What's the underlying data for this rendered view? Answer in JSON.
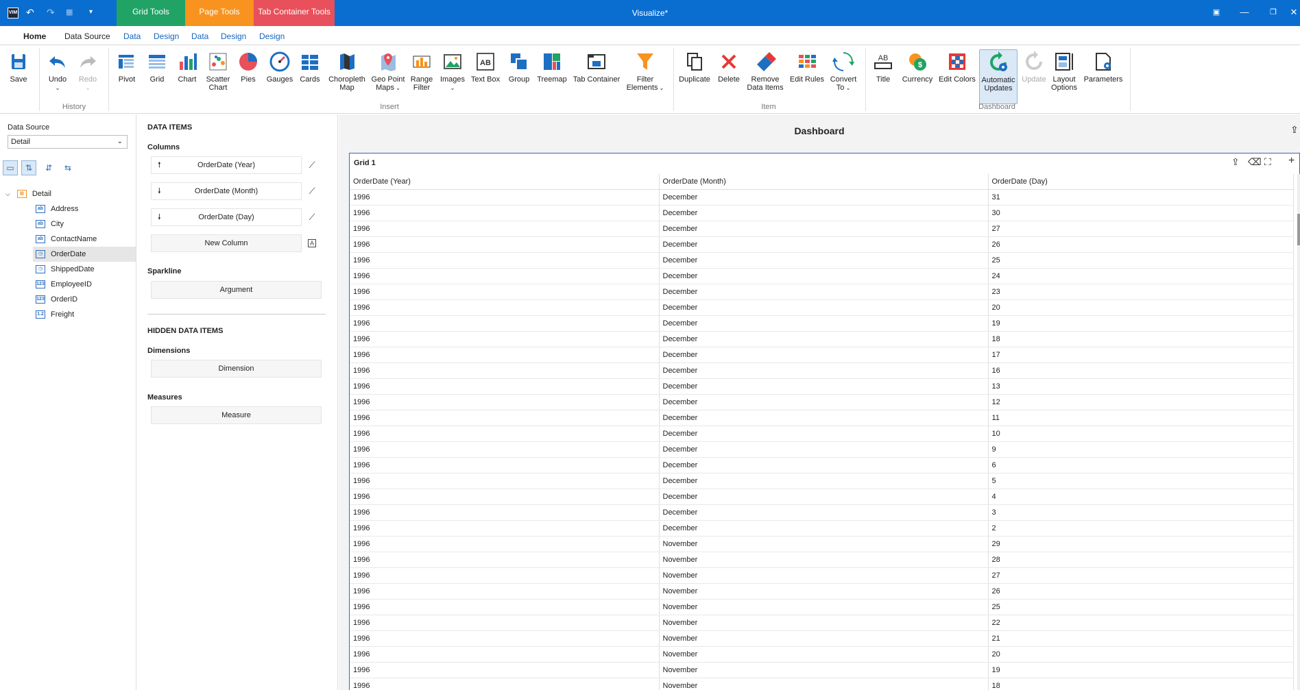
{
  "titlebar": {
    "app_title": "Visualize*",
    "logo": "VIM",
    "context_tabs": [
      {
        "label": "Grid Tools",
        "color": "#21a366"
      },
      {
        "label": "Page Tools",
        "color": "#f7931e"
      },
      {
        "label": "Tab Container Tools",
        "color": "#e8505b"
      }
    ]
  },
  "tabs": [
    "Home",
    "Data Source",
    "Data",
    "Design",
    "Data",
    "Design",
    "Design"
  ],
  "ribbon": {
    "save": "Save",
    "undo": "Undo",
    "redo": "Redo",
    "history": "History",
    "insert": {
      "label": "Insert",
      "items": [
        "Pivot",
        "Grid",
        "Chart",
        "Scatter Chart",
        "Pies",
        "Gauges",
        "Cards",
        "Choropleth Map",
        "Geo Point Maps",
        "Range Filter",
        "Images",
        "Text Box",
        "Group",
        "Treemap",
        "Tab Container",
        "Filter Elements"
      ]
    },
    "item": {
      "label": "Item",
      "items": [
        "Duplicate",
        "Delete",
        "Remove Data Items",
        "Edit Rules",
        "Convert To"
      ]
    },
    "dashboard": {
      "label": "Dashboard",
      "items": [
        "Title",
        "Currency",
        "Edit Colors",
        "Automatic Updates",
        "Update",
        "Layout Options",
        "Parameters"
      ]
    }
  },
  "left": {
    "data_source_label": "Data Source",
    "data_source_value": "Detail",
    "tree_root": "Detail",
    "fields": [
      {
        "name": "Address",
        "type": "ab"
      },
      {
        "name": "City",
        "type": "ab"
      },
      {
        "name": "ContactName",
        "type": "ab"
      },
      {
        "name": "OrderDate",
        "type": "date"
      },
      {
        "name": "ShippedDate",
        "type": "date"
      },
      {
        "name": "EmployeeID",
        "type": "123"
      },
      {
        "name": "OrderID",
        "type": "123"
      },
      {
        "name": "Freight",
        "type": "1.2"
      }
    ],
    "selected_field": "OrderDate"
  },
  "mid": {
    "data_items": "DATA ITEMS",
    "columns": "Columns",
    "column_items": [
      "OrderDate (Year)",
      "OrderDate (Month)",
      "OrderDate (Day)"
    ],
    "new_column": "New Column",
    "sparkline": "Sparkline",
    "argument": "Argument",
    "hidden_data_items": "HIDDEN DATA ITEMS",
    "dimensions": "Dimensions",
    "dimension": "Dimension",
    "measures": "Measures",
    "measure": "Measure"
  },
  "dashboard": {
    "title": "Dashboard",
    "grid_title": "Grid 1",
    "headers": [
      "OrderDate (Year)",
      "OrderDate (Month)",
      "OrderDate (Day)"
    ],
    "rows": [
      [
        "1996",
        "December",
        "31"
      ],
      [
        "1996",
        "December",
        "30"
      ],
      [
        "1996",
        "December",
        "27"
      ],
      [
        "1996",
        "December",
        "26"
      ],
      [
        "1996",
        "December",
        "25"
      ],
      [
        "1996",
        "December",
        "24"
      ],
      [
        "1996",
        "December",
        "23"
      ],
      [
        "1996",
        "December",
        "20"
      ],
      [
        "1996",
        "December",
        "19"
      ],
      [
        "1996",
        "December",
        "18"
      ],
      [
        "1996",
        "December",
        "17"
      ],
      [
        "1996",
        "December",
        "16"
      ],
      [
        "1996",
        "December",
        "13"
      ],
      [
        "1996",
        "December",
        "12"
      ],
      [
        "1996",
        "December",
        "11"
      ],
      [
        "1996",
        "December",
        "10"
      ],
      [
        "1996",
        "December",
        "9"
      ],
      [
        "1996",
        "December",
        "6"
      ],
      [
        "1996",
        "December",
        "5"
      ],
      [
        "1996",
        "December",
        "4"
      ],
      [
        "1996",
        "December",
        "3"
      ],
      [
        "1996",
        "December",
        "2"
      ],
      [
        "1996",
        "November",
        "29"
      ],
      [
        "1996",
        "November",
        "28"
      ],
      [
        "1996",
        "November",
        "27"
      ],
      [
        "1996",
        "November",
        "26"
      ],
      [
        "1996",
        "November",
        "25"
      ],
      [
        "1996",
        "November",
        "22"
      ],
      [
        "1996",
        "November",
        "21"
      ],
      [
        "1996",
        "November",
        "20"
      ],
      [
        "1996",
        "November",
        "19"
      ],
      [
        "1996",
        "November",
        "18"
      ]
    ]
  }
}
